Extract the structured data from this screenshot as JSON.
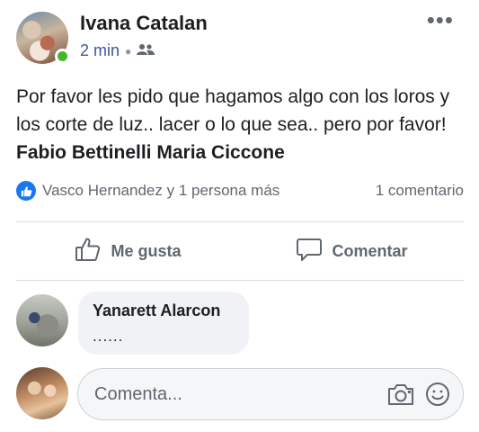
{
  "post": {
    "author": "Ivana Catalan",
    "time": "2 min",
    "text_plain": "Por favor les pido que hagamos algo con los loros y los corte de luz.. lacer o lo que sea.. pero por favor! ",
    "tag_1": "Fabio Bettinelli",
    "tag_2": "Maria Ciccone"
  },
  "reactions": {
    "summary": "Vasco Hernandez y 1 persona más",
    "comments_count": "1 comentario"
  },
  "actions": {
    "like_label": "Me gusta",
    "comment_label": "Comentar"
  },
  "comment": {
    "author": "Yanarett Alarcon",
    "text": "......"
  },
  "composer": {
    "placeholder": "Comenta..."
  },
  "colors": {
    "brand_blue": "#1877f2",
    "online_green": "#42b72a",
    "secondary_text": "#606770"
  },
  "icons": {
    "privacy": "friends-icon",
    "like": "thumbs-up-icon",
    "comment": "speech-bubble-icon",
    "camera": "camera-icon",
    "emoji": "smiley-icon",
    "more": "more-options-icon"
  }
}
